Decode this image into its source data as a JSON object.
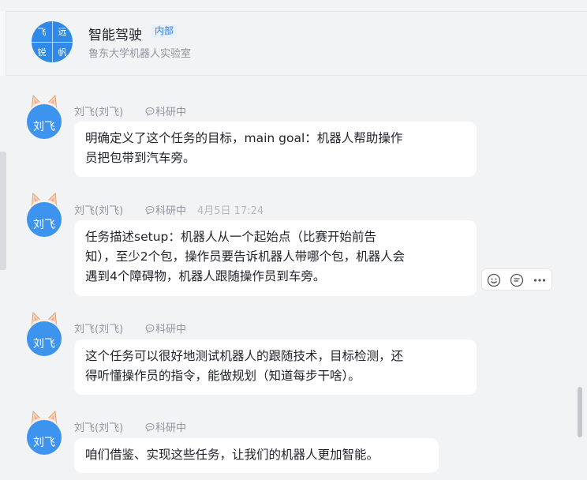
{
  "header": {
    "logo_chars": [
      "飞",
      "远",
      "锐",
      "帆"
    ],
    "group_name": "智能驾驶",
    "badge": "内部",
    "organization": "鲁东大学机器人实验室"
  },
  "colors": {
    "accent": "#2f89e8",
    "avatar": "#3d94ee",
    "background": "#f2f3f5",
    "bubble": "#ffffff",
    "badge_text": "#2f7ee8",
    "badge_bg": "#e5efff"
  },
  "messages": [
    {
      "avatar_text": "刘飞",
      "sender": "刘飞(刘飞)",
      "tag": "科研中",
      "time": "",
      "lines": [
        "明确定义了这个任务的目标，main goal：机器人帮助操作",
        "员把包带到汽车旁。"
      ]
    },
    {
      "avatar_text": "刘飞",
      "sender": "刘飞(刘飞)",
      "tag": "科研中",
      "time": "4月5日 17:24",
      "lines": [
        "任务描述setup：机器人从一个起始点（比赛开始前告",
        "知），至少2个包，操作员要告诉机器人带哪个包，机器人会",
        "遇到4个障碍物，机器人跟随操作员到车旁。"
      ]
    },
    {
      "avatar_text": "刘飞",
      "sender": "刘飞(刘飞)",
      "tag": "科研中",
      "time": "",
      "lines": [
        "这个任务可以很好地测试机器人的跟随技术，目标检测，还",
        "得听懂操作员的指令，能做规划（知道每步干啥）。"
      ]
    },
    {
      "avatar_text": "刘飞",
      "sender": "刘飞(刘飞)",
      "tag": "科研中",
      "time": "",
      "lines": [
        "咱们借鉴、实现这些任务，让我们的机器人更加智能。"
      ]
    }
  ],
  "hover_actions": [
    "emoji-reaction-icon",
    "reply-icon",
    "more-icon"
  ]
}
